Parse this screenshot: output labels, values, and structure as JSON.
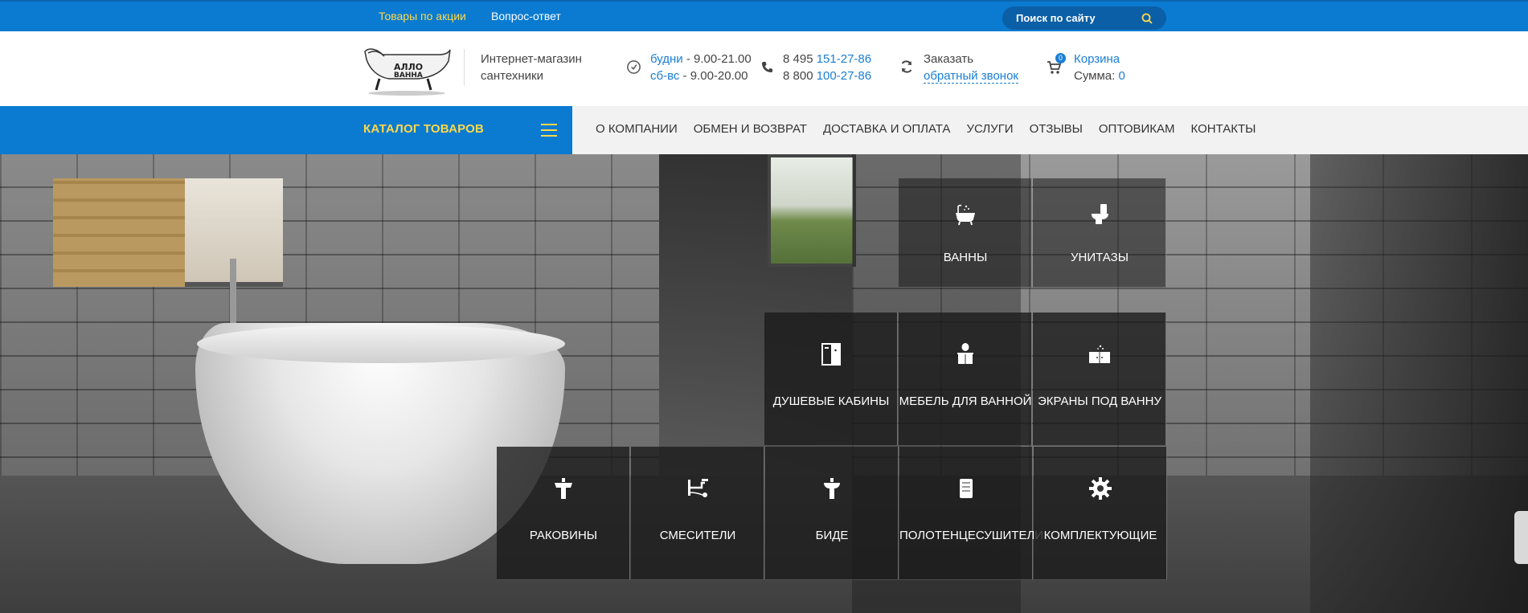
{
  "topbar": {
    "promo_link": "Товары по акции",
    "faq_link": "Вопрос-ответ",
    "search_placeholder": "Поиск по сайту"
  },
  "header": {
    "logo_icon": "bathtub-logo",
    "tagline_line1": "Интернет-магазин",
    "tagline_line2": "сантехники",
    "hours": {
      "weekdays_label": "будни",
      "weekdays_time": " - 9.00-21.00",
      "weekend_label": "сб-вс",
      "weekend_time": " - 9.00-20.00"
    },
    "phones": {
      "phone1_prefix": "8 495 ",
      "phone1_number": "151-27-86",
      "phone2_prefix": "8 800 ",
      "phone2_number": "100-27-86"
    },
    "callback": {
      "line1": "Заказать",
      "link": "обратный звонок"
    },
    "cart": {
      "count": "0",
      "label": "Корзина",
      "sum_label": "Сумма: ",
      "sum_value": "0"
    }
  },
  "nav": {
    "catalog_label": "КАТАЛОГ ТОВАРОВ",
    "items": [
      "О КОМПАНИИ",
      "ОБМЕН И ВОЗВРАТ",
      "ДОСТАВКА И ОПЛАТА",
      "УСЛУГИ",
      "ОТЗЫВЫ",
      "ОПТОВИКАМ",
      "КОНТАКТЫ"
    ]
  },
  "categories": [
    {
      "label": "ВАННЫ",
      "icon": "bathtub-icon"
    },
    {
      "label": "УНИТАЗЫ",
      "icon": "toilet-icon"
    },
    {
      "label": "ДУШЕВЫЕ КАБИНЫ",
      "icon": "shower-cabin-icon"
    },
    {
      "label": "МЕБЕЛЬ ДЛЯ ВАННОЙ",
      "icon": "bathroom-furniture-icon"
    },
    {
      "label": "ЭКРАНЫ ПОД ВАННУ",
      "icon": "bath-screen-icon"
    },
    {
      "label": "РАКОВИНЫ",
      "icon": "sink-icon"
    },
    {
      "label": "СМЕСИТЕЛИ",
      "icon": "faucet-icon"
    },
    {
      "label": "БИДЕ",
      "icon": "bidet-icon"
    },
    {
      "label": "ПОЛОТЕНЦЕСУШИТЕЛИ",
      "icon": "towel-warmer-icon"
    },
    {
      "label": "КОМПЛЕКТУЮЩИЕ",
      "icon": "gear-icon"
    }
  ],
  "colors": {
    "brand_blue": "#0a7bd1",
    "accent_yellow": "#ffd84a",
    "link_blue": "#1a7ed3"
  }
}
